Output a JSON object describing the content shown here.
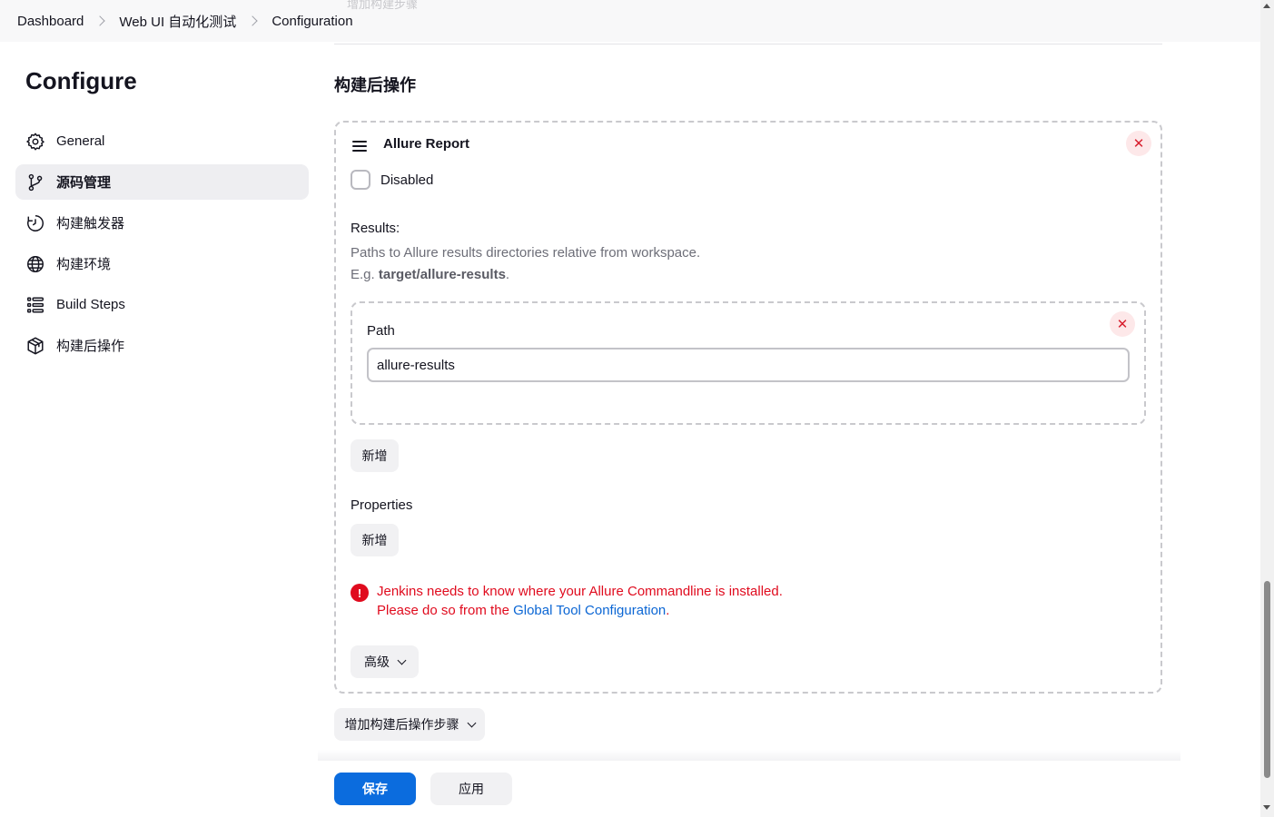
{
  "breadcrumb": {
    "items": [
      "Dashboard",
      "Web UI 自动化测试",
      "Configuration"
    ],
    "ghost_text": "增加构建步骤"
  },
  "sidebar": {
    "title": "Configure",
    "items": [
      {
        "label": "General",
        "icon": "gear-icon",
        "active": false
      },
      {
        "label": "源码管理",
        "icon": "branch-icon",
        "active": true
      },
      {
        "label": "构建触发器",
        "icon": "clock-icon",
        "active": false
      },
      {
        "label": "构建环境",
        "icon": "globe-icon",
        "active": false
      },
      {
        "label": "Build Steps",
        "icon": "list-icon",
        "active": false
      },
      {
        "label": "构建后操作",
        "icon": "package-icon",
        "active": false
      }
    ]
  },
  "main": {
    "section_title": "构建后操作",
    "allure": {
      "title": "Allure Report",
      "disabled_label": "Disabled",
      "results_label": "Results:",
      "results_help_line1": "Paths to Allure results directories relative from workspace.",
      "results_help_prefix": "E.g. ",
      "results_help_example": "target/allure-results",
      "results_help_suffix": ".",
      "path_label": "Path",
      "path_value": "allure-results",
      "add_results_label": "新增",
      "properties_label": "Properties",
      "add_properties_label": "新增",
      "error_line1": "Jenkins needs to know where your Allure Commandline is installed.",
      "error_line2_prefix": "Please do so from the ",
      "error_link": "Global Tool Configuration",
      "error_line2_suffix": ".",
      "advanced_label": "高级"
    },
    "add_post_build_label": "增加构建后操作步骤"
  },
  "footer": {
    "save_label": "保存",
    "apply_label": "应用"
  },
  "colors": {
    "primary": "#0b6cde",
    "error": "#e00b1e",
    "link": "#0b66d4",
    "active_nav_bg": "#eeeef1"
  }
}
